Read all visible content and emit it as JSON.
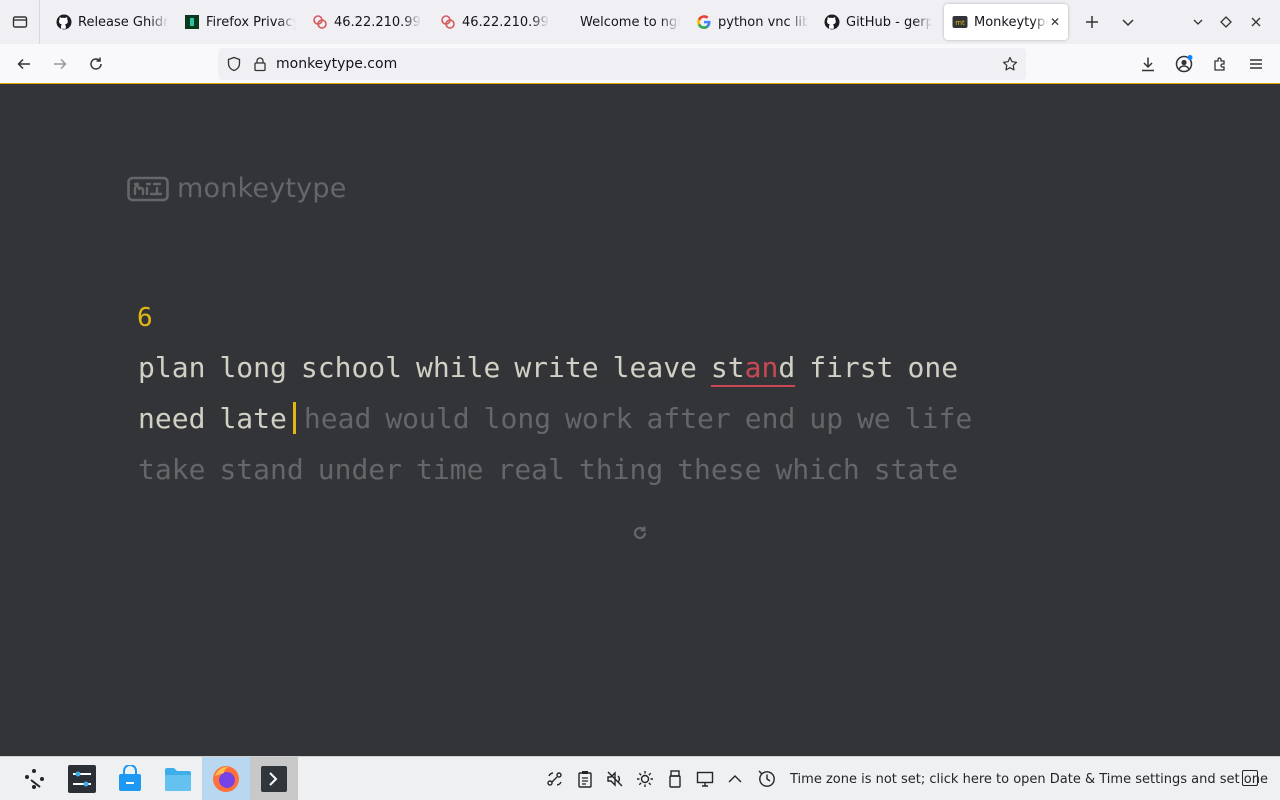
{
  "browser": {
    "tabs": [
      {
        "title": "Release Ghidra",
        "favicon": "github-icon"
      },
      {
        "title": "Firefox Privacy",
        "favicon": "firefox-privacy-icon"
      },
      {
        "title": "46.22.210.99",
        "favicon": "server-icon"
      },
      {
        "title": "46.22.210.99",
        "favicon": "server-icon"
      },
      {
        "title": "Welcome to nginx",
        "favicon": "none"
      },
      {
        "title": "python vnc lib",
        "favicon": "google-icon"
      },
      {
        "title": "GitHub - gerp",
        "favicon": "github-icon"
      },
      {
        "title": "Monkeytype",
        "favicon": "monkeytype-icon",
        "active": true
      }
    ],
    "url": "monkeytype.com"
  },
  "page": {
    "logo_text": "monkeytype",
    "word_counter": "6",
    "lines": [
      [
        "plan",
        "long",
        "school",
        "while",
        "write",
        "leave",
        "stand",
        "first",
        "one"
      ],
      [
        "need",
        "late",
        "head",
        "would",
        "long",
        "work",
        "after",
        "end",
        "up",
        "we",
        "life"
      ],
      [
        "take",
        "stand",
        "under",
        "time",
        "real",
        "thing",
        "these",
        "which",
        "state"
      ]
    ],
    "error_word": {
      "ok_prefix": "st",
      "wrong": "an",
      "ok_suffix": "d"
    }
  },
  "taskbar": {
    "clock_text": "Time zone is not set; click here to open Date & Time settings and set one"
  },
  "colors": {
    "background": "#323437",
    "main": "#e2b714",
    "text": "#d1d0c5",
    "sub": "#646669",
    "error": "#ca4754"
  }
}
